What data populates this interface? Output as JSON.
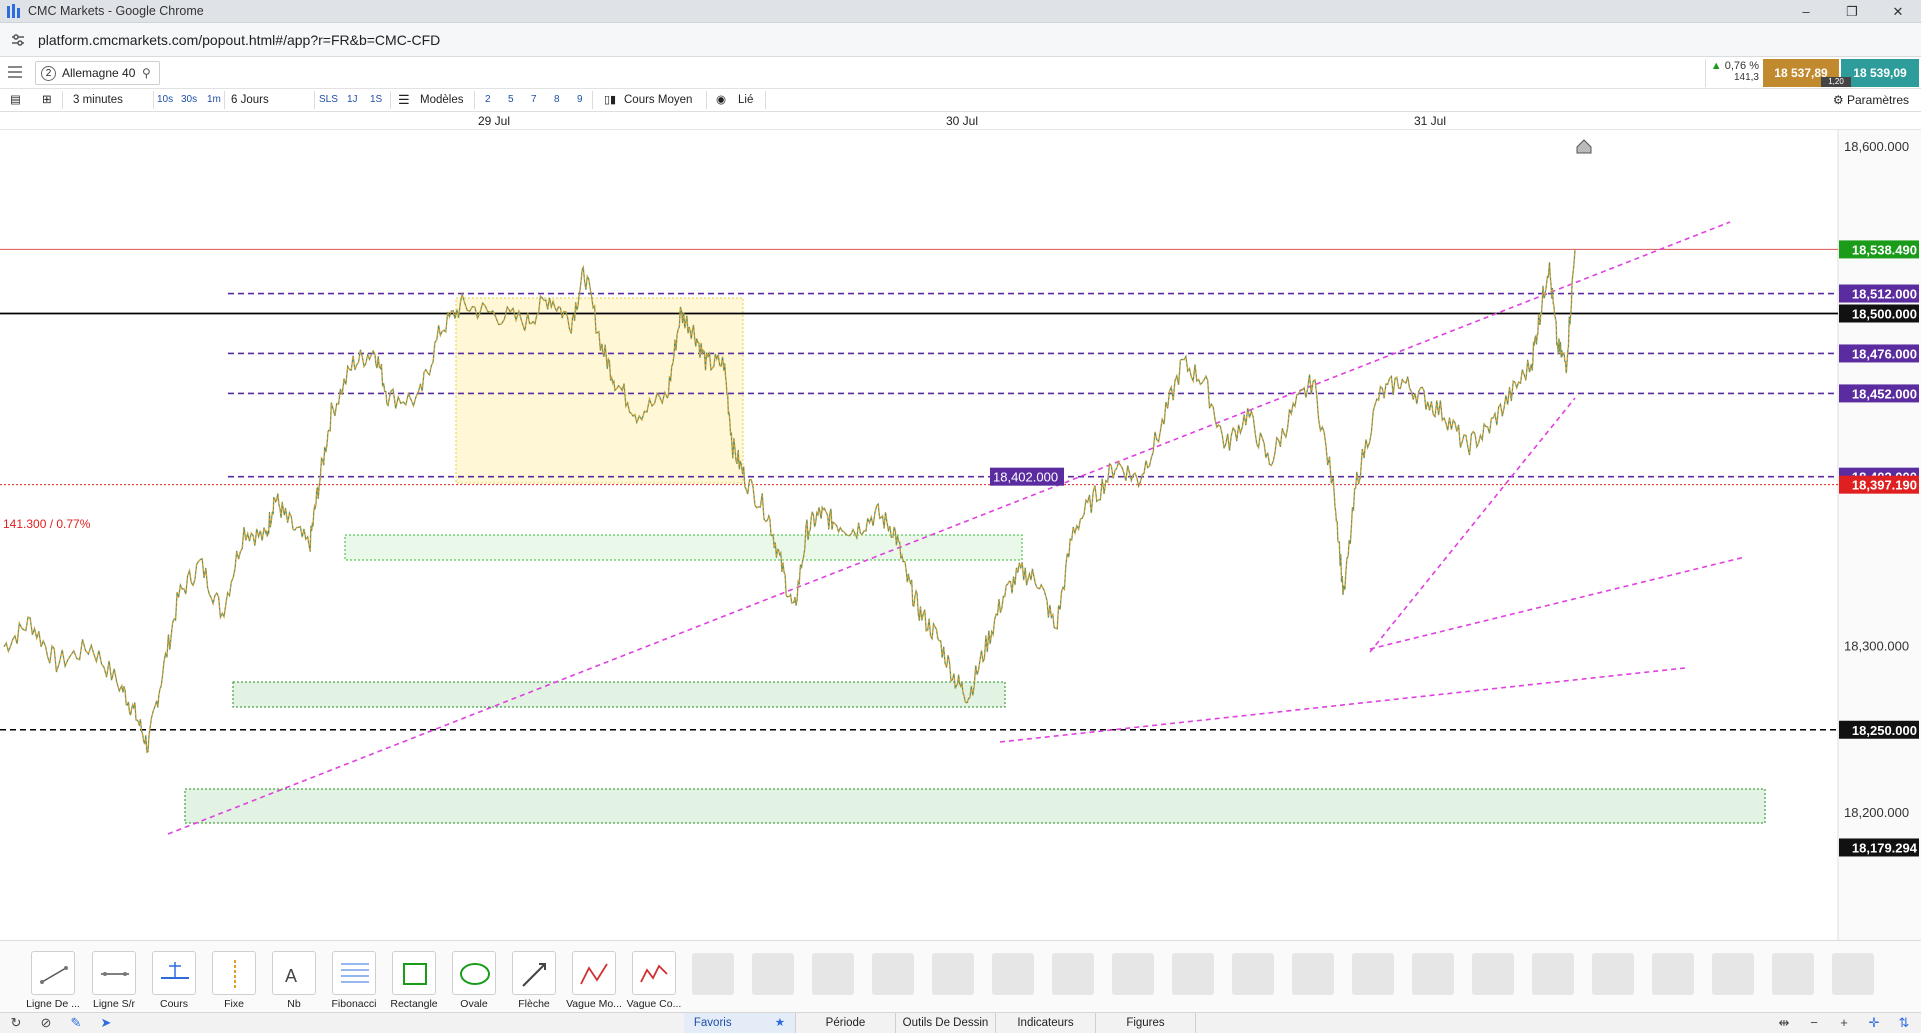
{
  "window": {
    "title": "CMC Markets - Google Chrome"
  },
  "browser": {
    "url": "platform.cmcmarkets.com/popout.html#/app?r=FR&b=CMC-CFD"
  },
  "instrument": {
    "slot_number": "2",
    "name": "Allemagne 40",
    "change_pct": "0,76 %",
    "change_pts": "141,3",
    "sell_price": "18 537,89",
    "buy_price": "18 539,09",
    "spread": "1,20"
  },
  "chart_toolbar": {
    "interval": "3 minutes",
    "quick_intervals": [
      "10s",
      "30s",
      "1m"
    ],
    "range": "6 Jours",
    "range_buttons": [
      "SLS",
      "1J",
      "1S"
    ],
    "templates_label": "Modèles",
    "template_slots": [
      "2",
      "5",
      "7",
      "8",
      "9"
    ],
    "price_type": "Cours Moyen",
    "linked_label": "Lié",
    "settings_label": "Paramètres"
  },
  "date_axis": [
    "29 Jul",
    "30 Jul",
    "31 Jul"
  ],
  "chart_data": {
    "type": "line",
    "instrument": "Allemagne 40",
    "interval": "3 minutes",
    "x_labels": [
      "29 Jul",
      "30 Jul",
      "31 Jul"
    ],
    "ylim": [
      18160,
      18650
    ],
    "y_ticks": [
      "18,600.000",
      "18,300.000",
      "18,200.000"
    ],
    "series": [
      {
        "points": [
          [
            0,
            18300
          ],
          [
            6,
            18315
          ],
          [
            12,
            18290
          ],
          [
            20,
            18300
          ],
          [
            27,
            18275
          ],
          [
            30,
            18260
          ],
          [
            33,
            18240
          ],
          [
            36,
            18280
          ],
          [
            40,
            18330
          ],
          [
            45,
            18350
          ],
          [
            50,
            18320
          ],
          [
            55,
            18370
          ],
          [
            60,
            18365
          ],
          [
            62,
            18390
          ],
          [
            65,
            18375
          ],
          [
            70,
            18360
          ],
          [
            72,
            18395
          ],
          [
            75,
            18440
          ],
          [
            80,
            18470
          ],
          [
            85,
            18478
          ],
          [
            88,
            18450
          ],
          [
            95,
            18448
          ],
          [
            100,
            18490
          ],
          [
            105,
            18505
          ],
          [
            112,
            18500
          ],
          [
            120,
            18495
          ],
          [
            125,
            18510
          ],
          [
            130,
            18495
          ],
          [
            133,
            18525
          ],
          [
            137,
            18480
          ],
          [
            140,
            18460
          ],
          [
            145,
            18440
          ],
          [
            152,
            18450
          ],
          [
            155,
            18500
          ],
          [
            158,
            18490
          ],
          [
            161,
            18470
          ],
          [
            165,
            18470
          ],
          [
            167,
            18420
          ],
          [
            170,
            18400
          ],
          [
            175,
            18380
          ],
          [
            178,
            18350
          ],
          [
            181,
            18320
          ],
          [
            184,
            18370
          ],
          [
            187,
            18380
          ],
          [
            190,
            18375
          ],
          [
            195,
            18370
          ],
          [
            200,
            18380
          ],
          [
            204,
            18370
          ],
          [
            207,
            18340
          ],
          [
            210,
            18320
          ],
          [
            214,
            18305
          ],
          [
            218,
            18280
          ],
          [
            221,
            18270
          ],
          [
            225,
            18300
          ],
          [
            229,
            18330
          ],
          [
            233,
            18345
          ],
          [
            237,
            18340
          ],
          [
            241,
            18310
          ],
          [
            245,
            18370
          ],
          [
            250,
            18390
          ],
          [
            255,
            18410
          ],
          [
            260,
            18400
          ],
          [
            265,
            18430
          ],
          [
            270,
            18470
          ],
          [
            275,
            18460
          ],
          [
            280,
            18420
          ],
          [
            285,
            18440
          ],
          [
            290,
            18410
          ],
          [
            295,
            18440
          ],
          [
            300,
            18460
          ],
          [
            305,
            18390
          ],
          [
            307,
            18330
          ],
          [
            310,
            18400
          ],
          [
            315,
            18450
          ],
          [
            320,
            18460
          ],
          [
            325,
            18450
          ],
          [
            330,
            18440
          ],
          [
            335,
            18420
          ],
          [
            340,
            18430
          ],
          [
            345,
            18450
          ],
          [
            350,
            18470
          ],
          [
            352,
            18500
          ],
          [
            354,
            18530
          ],
          [
            356,
            18480
          ],
          [
            358,
            18470
          ],
          [
            360,
            18538
          ]
        ],
        "x_range": [
          0,
          360
        ]
      }
    ],
    "horizontal_levels": [
      {
        "label": "18,538.490",
        "value": 18538.49,
        "color": "#d9534f",
        "style": "solid-thin",
        "badge": "#1a9c1a"
      },
      {
        "label": "18,512.000",
        "value": 18512,
        "color": "#5b2ca0",
        "style": "dashed",
        "badge": "#5b2ca0"
      },
      {
        "label": "18,500.000",
        "value": 18500,
        "color": "#000000",
        "style": "solid",
        "badge": "#111111"
      },
      {
        "label": "18,476.000",
        "value": 18476,
        "color": "#5b2ca0",
        "style": "dashed",
        "badge": "#5b2ca0"
      },
      {
        "label": "18,452.000",
        "value": 18452,
        "color": "#5b2ca0",
        "style": "dashed",
        "badge": "#5b2ca0"
      },
      {
        "label": "18,402.000",
        "value": 18402,
        "color": "#5b2ca0",
        "style": "dashed",
        "badge": "#5b2ca0"
      },
      {
        "label": "18,397.190",
        "value": 18397.19,
        "color": "#e02020",
        "style": "dotted",
        "badge": "#e02020"
      },
      {
        "label": "18,250.000",
        "value": 18250,
        "color": "#000000",
        "style": "dashed",
        "badge": "#111111"
      },
      {
        "label": "18,179.294",
        "value": 18179.294,
        "color": "#888888",
        "style": "none",
        "badge": "#111111"
      }
    ],
    "prev_close_label": "141.300 / 0.77%",
    "trendline_color": "#e040e0",
    "zones": [
      {
        "name": "consolidation-zone",
        "color": "#fff7d6"
      },
      {
        "name": "support-zone",
        "color": "#e3f5e3"
      }
    ]
  },
  "draw_tools": [
    {
      "label": "Ligne De ...",
      "icon": "line-tool-icon"
    },
    {
      "label": "Ligne S/r",
      "icon": "sr-line-icon"
    },
    {
      "label": "Cours",
      "icon": "price-line-icon"
    },
    {
      "label": "Fixe",
      "icon": "fixed-line-icon"
    },
    {
      "label": "Nb",
      "icon": "text-tool-icon"
    },
    {
      "label": "Fibonacci",
      "icon": "fibonacci-icon"
    },
    {
      "label": "Rectangle",
      "icon": "rectangle-icon"
    },
    {
      "label": "Ovale",
      "icon": "oval-icon"
    },
    {
      "label": "Flèche",
      "icon": "arrow-icon"
    },
    {
      "label": "Vague Mo...",
      "icon": "wave-icon"
    },
    {
      "label": "Vague Co...",
      "icon": "corrective-wave-icon"
    }
  ],
  "bottom_tabs": [
    "Favoris",
    "Période",
    "Outils De Dessin",
    "Indicateurs",
    "Figures"
  ]
}
